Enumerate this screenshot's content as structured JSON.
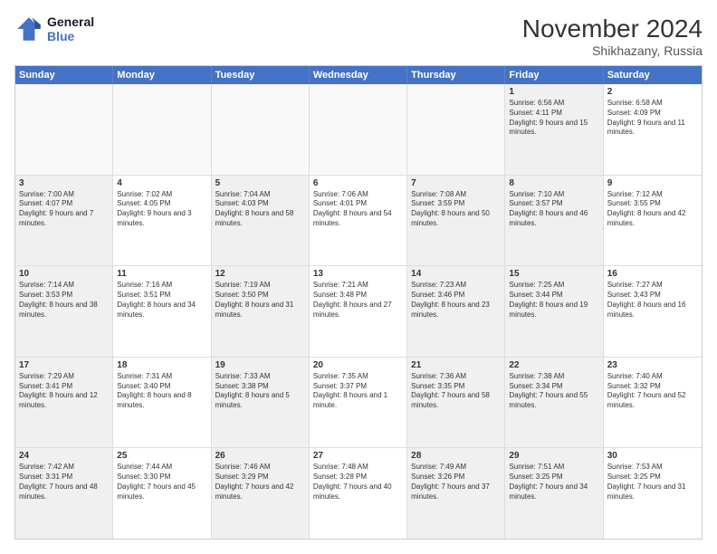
{
  "logo": {
    "line1": "General",
    "line2": "Blue"
  },
  "title": "November 2024",
  "subtitle": "Shikhazany, Russia",
  "header_days": [
    "Sunday",
    "Monday",
    "Tuesday",
    "Wednesday",
    "Thursday",
    "Friday",
    "Saturday"
  ],
  "rows": [
    [
      {
        "day": "",
        "info": "",
        "empty": true
      },
      {
        "day": "",
        "info": "",
        "empty": true
      },
      {
        "day": "",
        "info": "",
        "empty": true
      },
      {
        "day": "",
        "info": "",
        "empty": true
      },
      {
        "day": "",
        "info": "",
        "empty": true
      },
      {
        "day": "1",
        "info": "Sunrise: 6:56 AM\nSunset: 4:11 PM\nDaylight: 9 hours and 15 minutes.",
        "shaded": true
      },
      {
        "day": "2",
        "info": "Sunrise: 6:58 AM\nSunset: 4:09 PM\nDaylight: 9 hours and 11 minutes.",
        "shaded": false
      }
    ],
    [
      {
        "day": "3",
        "info": "Sunrise: 7:00 AM\nSunset: 4:07 PM\nDaylight: 9 hours and 7 minutes.",
        "shaded": true
      },
      {
        "day": "4",
        "info": "Sunrise: 7:02 AM\nSunset: 4:05 PM\nDaylight: 9 hours and 3 minutes.",
        "shaded": false
      },
      {
        "day": "5",
        "info": "Sunrise: 7:04 AM\nSunset: 4:03 PM\nDaylight: 8 hours and 58 minutes.",
        "shaded": true
      },
      {
        "day": "6",
        "info": "Sunrise: 7:06 AM\nSunset: 4:01 PM\nDaylight: 8 hours and 54 minutes.",
        "shaded": false
      },
      {
        "day": "7",
        "info": "Sunrise: 7:08 AM\nSunset: 3:59 PM\nDaylight: 8 hours and 50 minutes.",
        "shaded": true
      },
      {
        "day": "8",
        "info": "Sunrise: 7:10 AM\nSunset: 3:57 PM\nDaylight: 8 hours and 46 minutes.",
        "shaded": true
      },
      {
        "day": "9",
        "info": "Sunrise: 7:12 AM\nSunset: 3:55 PM\nDaylight: 8 hours and 42 minutes.",
        "shaded": false
      }
    ],
    [
      {
        "day": "10",
        "info": "Sunrise: 7:14 AM\nSunset: 3:53 PM\nDaylight: 8 hours and 38 minutes.",
        "shaded": true
      },
      {
        "day": "11",
        "info": "Sunrise: 7:16 AM\nSunset: 3:51 PM\nDaylight: 8 hours and 34 minutes.",
        "shaded": false
      },
      {
        "day": "12",
        "info": "Sunrise: 7:19 AM\nSunset: 3:50 PM\nDaylight: 8 hours and 31 minutes.",
        "shaded": true
      },
      {
        "day": "13",
        "info": "Sunrise: 7:21 AM\nSunset: 3:48 PM\nDaylight: 8 hours and 27 minutes.",
        "shaded": false
      },
      {
        "day": "14",
        "info": "Sunrise: 7:23 AM\nSunset: 3:46 PM\nDaylight: 8 hours and 23 minutes.",
        "shaded": true
      },
      {
        "day": "15",
        "info": "Sunrise: 7:25 AM\nSunset: 3:44 PM\nDaylight: 8 hours and 19 minutes.",
        "shaded": true
      },
      {
        "day": "16",
        "info": "Sunrise: 7:27 AM\nSunset: 3:43 PM\nDaylight: 8 hours and 16 minutes.",
        "shaded": false
      }
    ],
    [
      {
        "day": "17",
        "info": "Sunrise: 7:29 AM\nSunset: 3:41 PM\nDaylight: 8 hours and 12 minutes.",
        "shaded": true
      },
      {
        "day": "18",
        "info": "Sunrise: 7:31 AM\nSunset: 3:40 PM\nDaylight: 8 hours and 8 minutes.",
        "shaded": false
      },
      {
        "day": "19",
        "info": "Sunrise: 7:33 AM\nSunset: 3:38 PM\nDaylight: 8 hours and 5 minutes.",
        "shaded": true
      },
      {
        "day": "20",
        "info": "Sunrise: 7:35 AM\nSunset: 3:37 PM\nDaylight: 8 hours and 1 minute.",
        "shaded": false
      },
      {
        "day": "21",
        "info": "Sunrise: 7:36 AM\nSunset: 3:35 PM\nDaylight: 7 hours and 58 minutes.",
        "shaded": true
      },
      {
        "day": "22",
        "info": "Sunrise: 7:38 AM\nSunset: 3:34 PM\nDaylight: 7 hours and 55 minutes.",
        "shaded": true
      },
      {
        "day": "23",
        "info": "Sunrise: 7:40 AM\nSunset: 3:32 PM\nDaylight: 7 hours and 52 minutes.",
        "shaded": false
      }
    ],
    [
      {
        "day": "24",
        "info": "Sunrise: 7:42 AM\nSunset: 3:31 PM\nDaylight: 7 hours and 48 minutes.",
        "shaded": true
      },
      {
        "day": "25",
        "info": "Sunrise: 7:44 AM\nSunset: 3:30 PM\nDaylight: 7 hours and 45 minutes.",
        "shaded": false
      },
      {
        "day": "26",
        "info": "Sunrise: 7:46 AM\nSunset: 3:29 PM\nDaylight: 7 hours and 42 minutes.",
        "shaded": true
      },
      {
        "day": "27",
        "info": "Sunrise: 7:48 AM\nSunset: 3:28 PM\nDaylight: 7 hours and 40 minutes.",
        "shaded": false
      },
      {
        "day": "28",
        "info": "Sunrise: 7:49 AM\nSunset: 3:26 PM\nDaylight: 7 hours and 37 minutes.",
        "shaded": true
      },
      {
        "day": "29",
        "info": "Sunrise: 7:51 AM\nSunset: 3:25 PM\nDaylight: 7 hours and 34 minutes.",
        "shaded": true
      },
      {
        "day": "30",
        "info": "Sunrise: 7:53 AM\nSunset: 3:25 PM\nDaylight: 7 hours and 31 minutes.",
        "shaded": false
      }
    ]
  ]
}
